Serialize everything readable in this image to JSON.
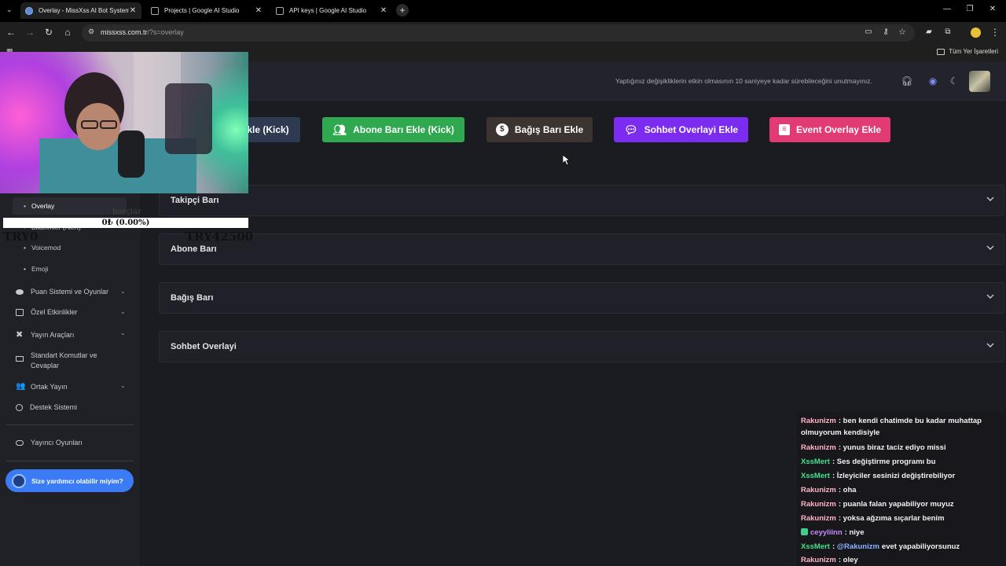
{
  "browser": {
    "tabs": [
      {
        "title": "Overlay - MissXss AI Bot System",
        "active": true,
        "icon": "globe-icon"
      },
      {
        "title": "Projects | Google AI Studio",
        "active": false,
        "icon": "page-icon"
      },
      {
        "title": "API keys | Google AI Studio",
        "active": false,
        "icon": "page-icon"
      }
    ],
    "new_tab": "+",
    "url_host": "missxss.com.tr",
    "url_path": "/?s=overlay",
    "bookmarks_all": "Tüm Yer İşaretleri"
  },
  "topbar": {
    "notice": "Yaptığınız değişikliklerin etkin olmasının 10 saniyeye kadar sürebileceğini unutmayınız."
  },
  "actions": [
    {
      "label": "kle (Kick)",
      "color": "#2d3a52",
      "icon": "none"
    },
    {
      "label": "Abone Barı Ekle (Kick)",
      "color": "#2fa84f",
      "icon": "users-icon"
    },
    {
      "label": "Bağış Barı Ekle",
      "color": "#3b3430",
      "icon": "money-bag-icon"
    },
    {
      "label": "Sohbet Overlayi Ekle",
      "color": "#7b2cf0",
      "icon": "chat-bubbles-icon"
    },
    {
      "label": "Event Overlay Ekle",
      "color": "#e23a72",
      "icon": "list-icon"
    }
  ],
  "accordions": [
    "Takipçi Barı",
    "Abone Barı",
    "Bağış Barı",
    "Sohbet Overlayi"
  ],
  "sidebar": {
    "subitems": [
      "Overlay",
      "Bildirimler (Alert)",
      "Voicemod",
      "Emoji"
    ],
    "items": [
      {
        "label": "Puan Sistemi ve Oyunlar",
        "icon": "coins-icon",
        "expandable": true
      },
      {
        "label": "Özel Etkinlikler",
        "icon": "calendar-icon",
        "expandable": true
      },
      {
        "label": "Yayın Araçları",
        "icon": "tools-icon",
        "expandable": true
      },
      {
        "label": "Standart Komutlar ve Cevaplar",
        "icon": "keyboard-icon",
        "expandable": false
      },
      {
        "label": "Ortak Yayın",
        "icon": "users-icon",
        "expandable": true
      },
      {
        "label": "Destek Sistemi",
        "icon": "support-icon",
        "expandable": false
      },
      {
        "label": "Yayıncı Oyunları",
        "icon": "gamepad-icon",
        "expandable": false
      }
    ],
    "assistant": "Size yardımcı olabilir miyim?"
  },
  "stream_overlay": {
    "goal_label": "borçlar",
    "goal_progress_text": "0₺ (0.00%)",
    "goal_progress": 0,
    "goal_min": "TRY0",
    "goal_max": "TRY42500"
  },
  "chat": [
    {
      "user": "Rakunizm",
      "color": "#ffb3c6",
      "text": ": ben kendi chatimde bu kadar muhattap olmuyorum kendisiyle"
    },
    {
      "user": "Rakunizm",
      "color": "#ffb3c6",
      "text": ": yunus biraz taciz ediyo missi"
    },
    {
      "user": "XssMert",
      "color": "#45e08a",
      "text": ": Ses değiştirme programı bu"
    },
    {
      "user": "XssMert",
      "color": "#45e08a",
      "text": ": İzleyiciler sesinizi değiştirebiliyor"
    },
    {
      "user": "Rakunizm",
      "color": "#ffb3c6",
      "text": ": oha"
    },
    {
      "user": "Rakunizm",
      "color": "#ffb3c6",
      "text": ": puanla falan yapabiliyor muyuz"
    },
    {
      "user": "Rakunizm",
      "color": "#ffb3c6",
      "text": ": yoksa ağzıma sıçarlar benim"
    },
    {
      "user": "ceyyliinn",
      "color": "#c58cff",
      "text": ": niye",
      "badge": true
    },
    {
      "user": "XssMert",
      "color": "#45e08a",
      "mention": "@Rakunizm",
      "mention_color": "#8ab4ff",
      "text": "evet yapabiliyorsunuz"
    },
    {
      "user": "Rakunizm",
      "color": "#ffb3c6",
      "text": ": oley"
    }
  ]
}
